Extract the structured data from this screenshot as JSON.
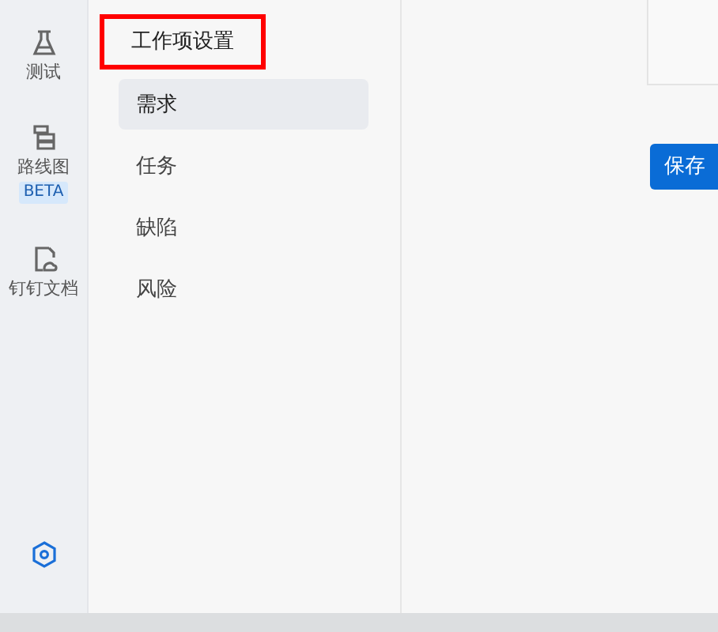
{
  "rail": [
    {
      "kind": "test",
      "label": "测试",
      "selected": false
    },
    {
      "kind": "roadmap",
      "label": "路线图",
      "badge": "BETA",
      "selected": false
    },
    {
      "kind": "doc",
      "label": "钉钉文档",
      "selected": false
    },
    {
      "kind": "settings",
      "selected": true
    }
  ],
  "menu": {
    "heading": "工作项设置",
    "heading_annotated": true,
    "items": [
      {
        "label": "需求",
        "selected": true
      },
      {
        "label": "任务",
        "selected": false
      },
      {
        "label": "缺陷",
        "selected": false
      },
      {
        "label": "风险",
        "selected": false
      }
    ]
  },
  "save_button": "保存"
}
